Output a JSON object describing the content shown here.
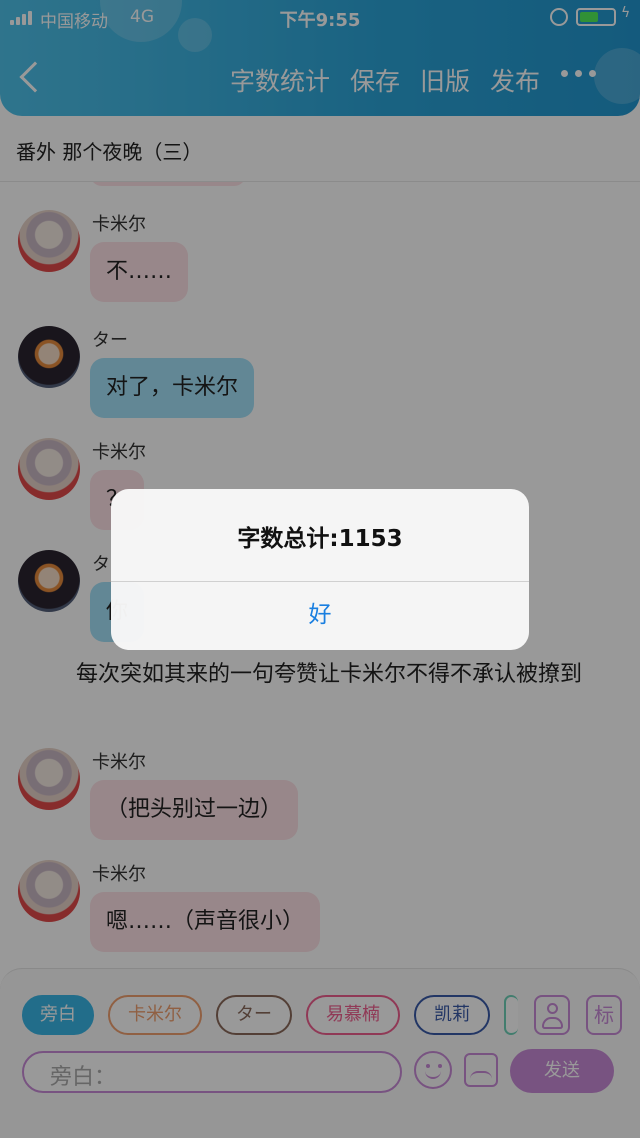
{
  "status_bar": {
    "carrier": "中国移动",
    "network": "4G",
    "time": "下午9:55",
    "battery_level": 0.55
  },
  "header": {
    "actions": [
      {
        "label": "字数统计"
      },
      {
        "label": "保存"
      },
      {
        "label": "旧版"
      },
      {
        "label": "发布"
      }
    ]
  },
  "chapter_title": "番外 那个夜晚（三）",
  "messages": [
    {
      "avatar": "kamil-avatar",
      "name": "卡米尔",
      "text": "不……"
    },
    {
      "avatar": "taa-avatar",
      "name": "ター",
      "text": "对了，卡米尔"
    },
    {
      "avatar": "kamil-avatar",
      "name": "卡米尔",
      "text": "？"
    },
    {
      "avatar": "taa-avatar",
      "name": "タ",
      "text": "你"
    },
    {
      "avatar": "kamil-avatar",
      "name": "卡米尔",
      "text": "（把头别过一边）"
    },
    {
      "avatar": "kamil-avatar",
      "name": "卡米尔",
      "text": "嗯……（声音很小）"
    }
  ],
  "narration": "每次突如其来的一句夸赞让卡米尔不得不承认被撩到",
  "characters": [
    {
      "label": "旁白",
      "color": "#3ab6e6",
      "selected": true
    },
    {
      "label": "卡米尔",
      "color": "#f0a070",
      "selected": false
    },
    {
      "label": "ター",
      "color": "#8a6a5a",
      "selected": false
    },
    {
      "label": "易慕楠",
      "color": "#f06090",
      "selected": false
    },
    {
      "label": "凯莉",
      "color": "#3a5aa8",
      "selected": false
    }
  ],
  "composer": {
    "placeholder": "旁白：",
    "send_label": "发送",
    "tag_label": "标"
  },
  "alert": {
    "title": "字数总计:1153",
    "button_label": "好"
  },
  "colors": {
    "header": "#2ba4d8",
    "accent": "#c98ad8",
    "alert_button": "#1a7fe0"
  }
}
